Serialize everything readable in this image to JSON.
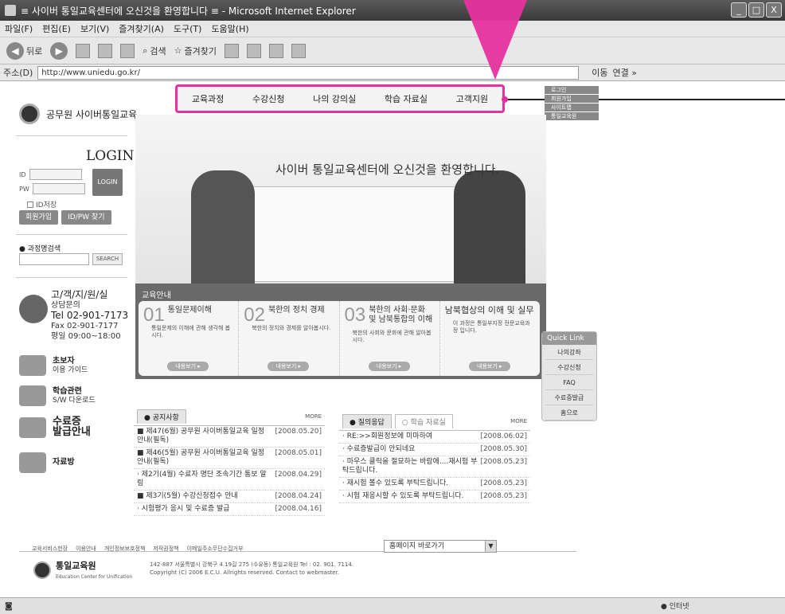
{
  "window": {
    "title": "≡ 사이버 통일교육센터에 오신것을 환영합니다 ≡ - Microsoft Internet Explorer",
    "controls": [
      "_",
      "□",
      "X"
    ]
  },
  "menubar": [
    "파일(F)",
    "편집(E)",
    "보기(V)",
    "즐겨찾기(A)",
    "도구(T)",
    "도움말(H)"
  ],
  "toolbar": {
    "back": "뒤로",
    "search": "검색",
    "favorites": "즐겨찾기"
  },
  "address": {
    "label": "주소(D)",
    "url": "http://www.uniedu.go.kr/",
    "go": "이동",
    "links": "연결 »"
  },
  "site": {
    "logo_text": "공무원 사이버통일교육",
    "login": {
      "title": "LOGIN",
      "id_label": "ID",
      "pw_label": "PW",
      "button": "LOGIN",
      "save_id": "ID저장",
      "join": "회원가입",
      "find": "ID/PW 찾기"
    },
    "course_search": {
      "label": "과정명검색",
      "button": "SEARCH"
    },
    "contact": {
      "title": "고/객/지/원/실",
      "sub": "상담문의",
      "tel": "Tel  02-901-7173",
      "fax": "Fax  02-901-7177",
      "hours": "평일 09:00~18:00"
    },
    "guides": [
      {
        "title": "초보자",
        "sub": "이용 가이드"
      },
      {
        "title": "학습관련",
        "sub": "S/W 다운로드"
      },
      {
        "title": "수료증",
        "sub": "발급안내"
      },
      {
        "title": "자료방",
        "sub": ""
      }
    ],
    "nav": [
      "교육과정",
      "수강신청",
      "나의 강의실",
      "학습 자료실",
      "고객지원"
    ],
    "right_links": [
      "로그인",
      "회원가입",
      "사이트맵",
      "통일교육원"
    ],
    "hero_welcome": "사이버 통일교육센터에 오신것을 환영합니다.",
    "edu": {
      "title": "교육안내",
      "more": "내용보기 ▸",
      "cards": [
        {
          "num": "01",
          "name": "통일문제이해",
          "desc": "통일문제의 이해에 관해 생각해 봅시다."
        },
        {
          "num": "02",
          "name": "북한의 정치 경제",
          "desc": "북한의 정치와 경제를 알아봅시다."
        },
        {
          "num": "03",
          "name": "북한의 사회·문화 및 남북통합의 이해",
          "desc": "북한의 사회와 문화에 관해 알아봅시다."
        },
        {
          "num": "",
          "name": "남북협상의 이해 및 실무",
          "desc": "이 과정은 통일부지정 전문교육과정 입니다."
        }
      ]
    },
    "quick": {
      "title": "Quick Link",
      "items": [
        "나의강좌",
        "수강신청",
        "FAQ",
        "수료증발급",
        "홈으로"
      ]
    },
    "notice": {
      "tab": "공지사항",
      "more": "MORE",
      "rows": [
        {
          "text": "■ 제47(6월) 공무원 사이버통일교육 일정 안내(필독)",
          "date": "[2008.05.20]"
        },
        {
          "text": "■ 제46(5월) 공무원 사이버통일교육 일정 안내(필독)",
          "date": "[2008.05.01]"
        },
        {
          "text": "· 제2기(4월) 수료자 명단 조속기간 통보 알림",
          "date": "[2008.04.29]"
        },
        {
          "text": "■ 제3기(5월) 수강신청접수 안내",
          "date": "[2008.04.24]"
        },
        {
          "text": "· 시험평가 응시 및 수료증 발급",
          "date": "[2008.04.16]"
        }
      ]
    },
    "qa": {
      "tab1": "질의응답",
      "tab2": "학습 자료실",
      "more": "MORE",
      "rows": [
        {
          "text": "· RE:>>회원정보에 미마하여",
          "date": "[2008.06.02]"
        },
        {
          "text": "· 수료증발급이 안되네요",
          "date": "[2008.05.30]"
        },
        {
          "text": "· 마우스 클릭을 절묘하는 바람에....재시험 부탁드립니다.",
          "date": "[2008.05.23]"
        },
        {
          "text": "· 재시험 볼수 있도록 부탁드립니다.",
          "date": "[2008.05.23]"
        },
        {
          "text": "· 시험 재응시할 수 있도록 부탁드립니다.",
          "date": "[2008.05.23]"
        }
      ]
    },
    "footer": {
      "links": [
        "교육서비스헌장",
        "이용안내",
        "개인정보보호정책",
        "저작권정책",
        "이메일주소무단수집거부"
      ],
      "family_select": "홈페이지 바로가기",
      "org_name": "통일교육원",
      "org_en": "Education Center for Unification",
      "address": "142-887 서울특별시 강북구 4.19길 275 (수유동) 통일교육원  Tel : 02. 901. 7114.",
      "copyright": "Copyright (C) 2006 E.C.U. Allrights reserved. Contact to webmaster."
    }
  },
  "status": {
    "left": "",
    "zone": "인터넷"
  },
  "colors": {
    "highlight": "#e6319e"
  }
}
